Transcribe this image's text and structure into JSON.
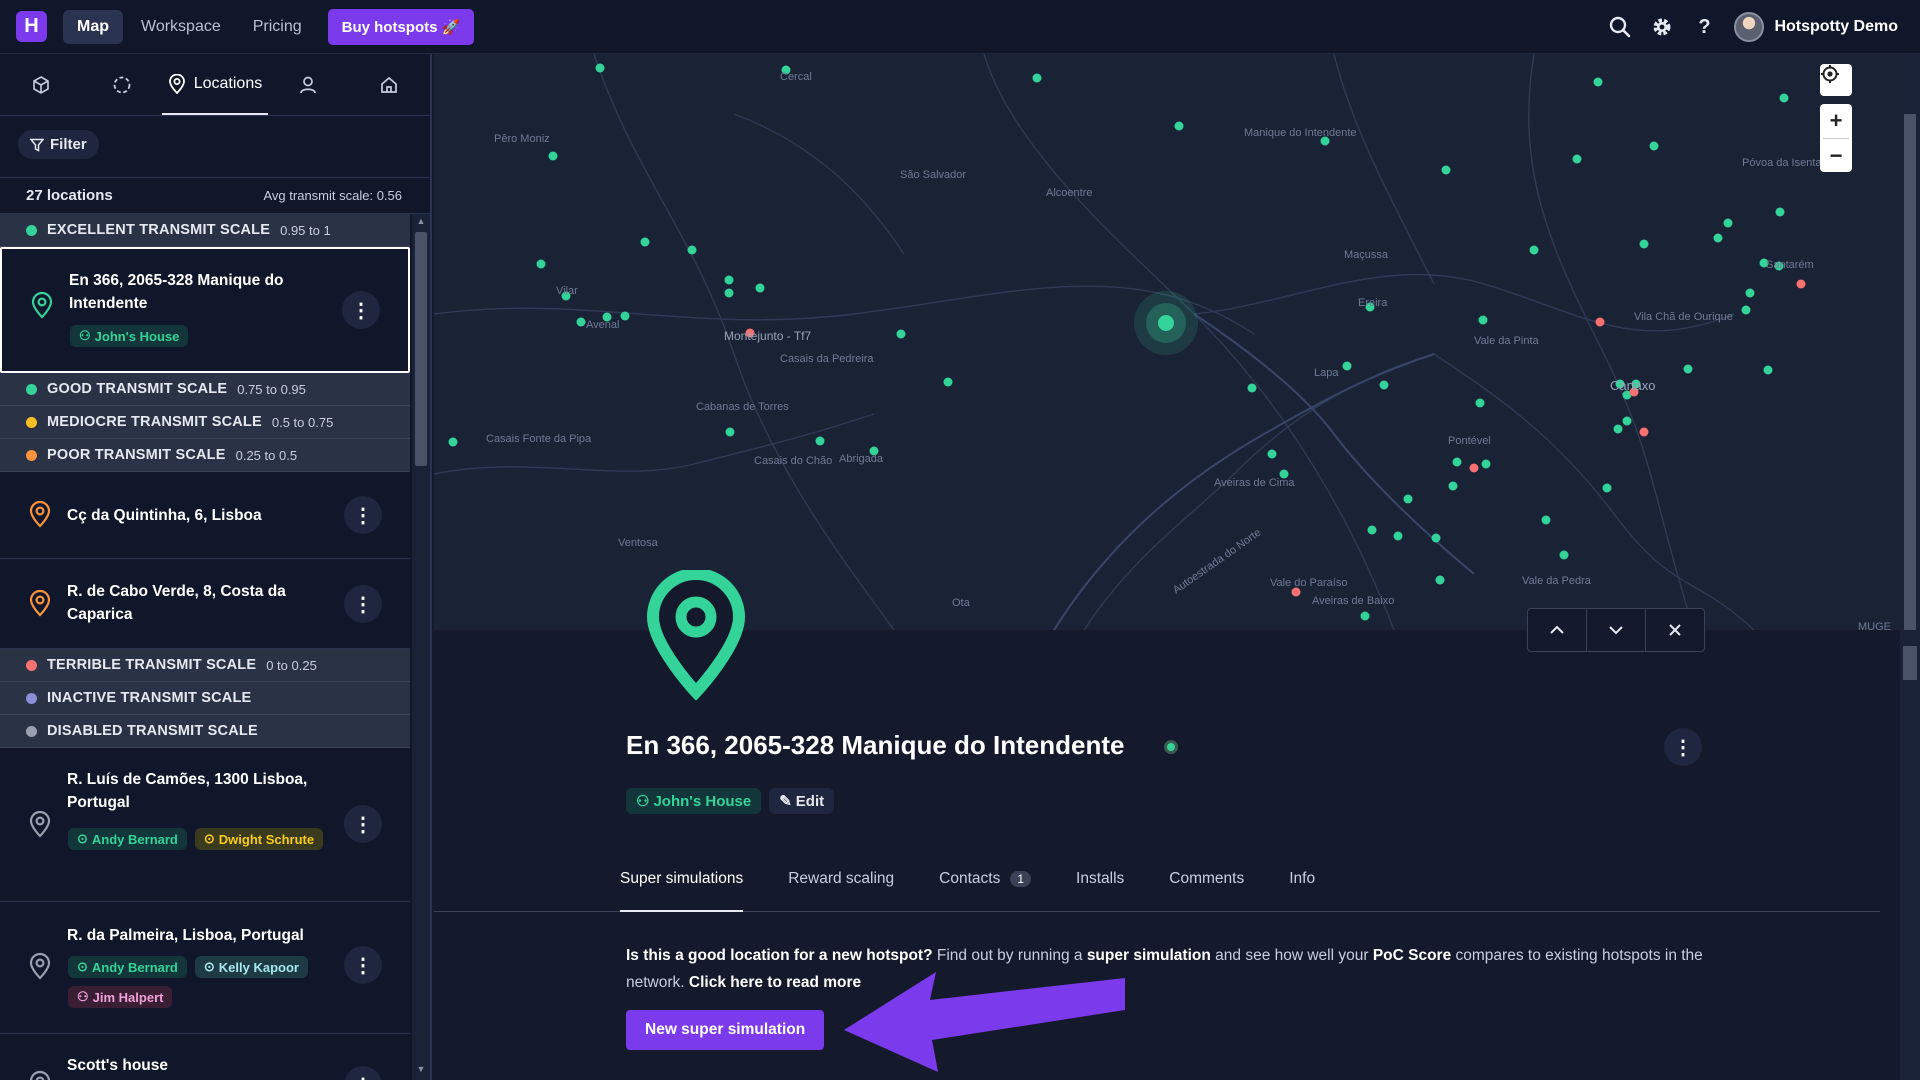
{
  "topbar": {
    "logo": "H",
    "nav": [
      "Map",
      "Workspace",
      "Pricing"
    ],
    "buy_label": "Buy hotspots",
    "user_name": "Hotspotty Demo"
  },
  "sidebar": {
    "tabs": [
      "Locations"
    ],
    "filter_label": "Filter",
    "count": "27 locations",
    "avg": "Avg transmit scale: 0.56",
    "groups": {
      "excellent": {
        "name": "EXCELLENT TRANSMIT SCALE",
        "range": "0.95 to 1",
        "color": "#34d399"
      },
      "good": {
        "name": "GOOD TRANSMIT SCALE",
        "range": "0.75 to 0.95",
        "color": "#34d399"
      },
      "mediocre": {
        "name": "MEDIOCRE TRANSMIT SCALE",
        "range": "0.5 to 0.75",
        "color": "#fbbf24"
      },
      "poor": {
        "name": "POOR TRANSMIT SCALE",
        "range": "0.25 to 0.5",
        "color": "#fb923c"
      },
      "terrible": {
        "name": "TERRIBLE TRANSMIT SCALE",
        "range": "0 to 0.25",
        "color": "#f87171"
      },
      "inactive": {
        "name": "INACTIVE TRANSMIT SCALE",
        "color": "#8b8fd8"
      },
      "disabled": {
        "name": "DISABLED TRANSMIT SCALE",
        "color": "#9aa0ad"
      }
    },
    "locations": [
      {
        "title": "En 366, 2065-328 Manique do Intendente",
        "tags": [
          "John's House"
        ]
      },
      {
        "title": "Cç da Quintinha, 6, Lisboa",
        "tags": []
      },
      {
        "title": "R. de Cabo Verde, 8, Costa da Caparica",
        "tags": []
      },
      {
        "title": "R. Luís de Camões, 1300 Lisboa, Portugal",
        "tags": [
          "Andy Bernard",
          "Dwight Schrute"
        ]
      },
      {
        "title": "R. da Palmeira, Lisboa, Portugal",
        "tags": [
          "Andy Bernard",
          "Kelly Kapoor",
          "Jim Halpert"
        ]
      },
      {
        "title": "Scott's house",
        "tags": []
      }
    ]
  },
  "map": {
    "labels": [
      "Pêro Moniz",
      "Cercal",
      "São Salvador",
      "Alcoentre",
      "Manique do Intendente",
      "Maçussa",
      "Vilar",
      "Avenal",
      "Montejunto - Tf7",
      "Casais da Pedreira",
      "Cabanas de Torres",
      "Casais Fonte da Pipa",
      "Casais do Chão",
      "Abrigada",
      "Ventosa",
      "Ota",
      "Aveiras de Cima",
      "Ereira",
      "Lapa",
      "Vale da Pinta",
      "Vila Chã de Ourique",
      "Cartaxo",
      "Pontével",
      "Póvoa da Isenta",
      "Santarém",
      "Autoestrada do Norte",
      "Vale do Paraíso",
      "Aveiras de Baixo",
      "Vale da Pedra",
      "MUGE"
    ],
    "zoom_in": "+",
    "zoom_out": "−"
  },
  "detail": {
    "title": "En 366, 2065-328 Manique do Intendente",
    "owner_tag": "John's House",
    "edit_label": "Edit",
    "tabs": [
      "Super simulations",
      "Reward scaling",
      "Contacts",
      "Installs",
      "Comments",
      "Info"
    ],
    "contacts_count": "1",
    "sim_q": "Is this a good location for a new hotspot?",
    "sim_t1": " Find out by running a ",
    "sim_b1": "super simulation",
    "sim_t2": " and see how well your ",
    "sim_b2": "PoC Score",
    "sim_t3": " compares to existing hotspots in the network. ",
    "sim_link": "Click here to read more",
    "sim_btn": "New super simulation"
  }
}
